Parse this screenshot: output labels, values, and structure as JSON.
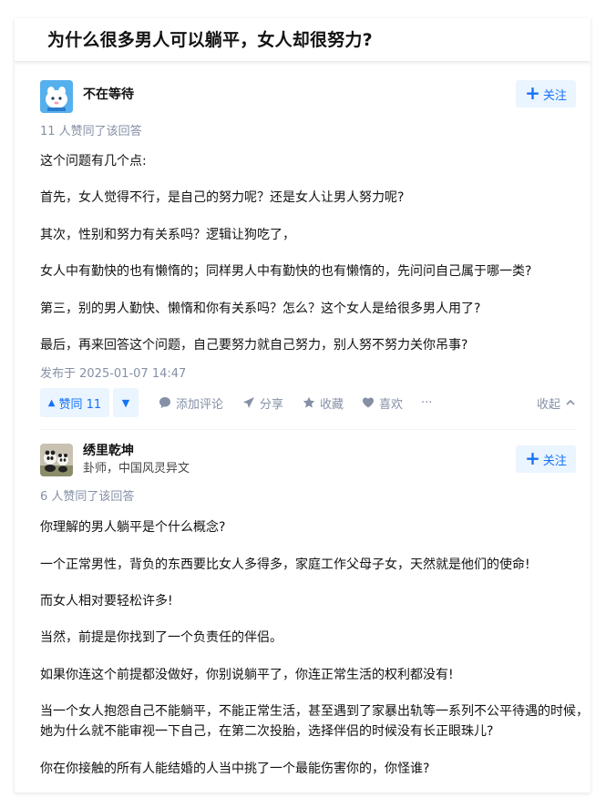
{
  "question": {
    "title": "为什么很多男人可以躺平，女人却很努力?"
  },
  "answers": [
    {
      "author": {
        "name": "不在等待",
        "bio": ""
      },
      "follow_label": "关注",
      "votes_text": "11 人赞同了该回答",
      "paragraphs": [
        "这个问题有几个点:",
        "首先，女人觉得不行，是自己的努力呢？还是女人让男人努力呢?",
        "其次，性别和努力有关系吗？逻辑让狗吃了，",
        "女人中有勤快的也有懒惰的；同样男人中有勤快的也有懒惰的，先问问自己属于哪一类?",
        "第三，别的男人勤快、懒惰和你有关系吗？怎么？这个女人是给很多男人用了?",
        "最后，再来回答这个问题，自己要努力就自己努力，别人努不努力关你吊事?"
      ],
      "published": "发布于 2025-01-07 14:47",
      "actions": {
        "vote_up": "赞同 11",
        "comment": "添加评论",
        "share": "分享",
        "collect": "收藏",
        "like": "喜欢",
        "more": "···",
        "collapse": "收起"
      }
    },
    {
      "author": {
        "name": "绣里乾坤",
        "bio": "卦师，中国风灵异文"
      },
      "follow_label": "关注",
      "votes_text": "6 人赞同了该回答",
      "paragraphs": [
        "你理解的男人躺平是个什么概念?",
        "一个正常男性，背负的东西要比女人多得多，家庭工作父母子女，天然就是他们的使命!",
        "而女人相对要轻松许多!",
        "当然，前提是你找到了一个负责任的伴侣。",
        "如果你连这个前提都没做好，你别说躺平了，你连正常生活的权利都没有!",
        "当一个女人抱怨自己不能躺平，不能正常生活，甚至遇到了家暴出轨等一系列不公平待遇的时候，",
        "她为什么就不能审视一下自己，在第二次投胎，选择伴侣的时候没有长正眼珠儿?",
        "你在你接触的所有人能结婚的人当中挑了一个最能伤害你的，你怪谁?"
      ]
    }
  ],
  "colors": {
    "accent": "#1772f6",
    "accent_bg": "#ebf5ff",
    "muted": "#8590a6"
  },
  "icons": [
    "plus-icon",
    "triangle-up-icon",
    "triangle-down-icon",
    "comment-icon",
    "share-icon",
    "star-icon",
    "heart-icon",
    "chevron-up-icon"
  ]
}
